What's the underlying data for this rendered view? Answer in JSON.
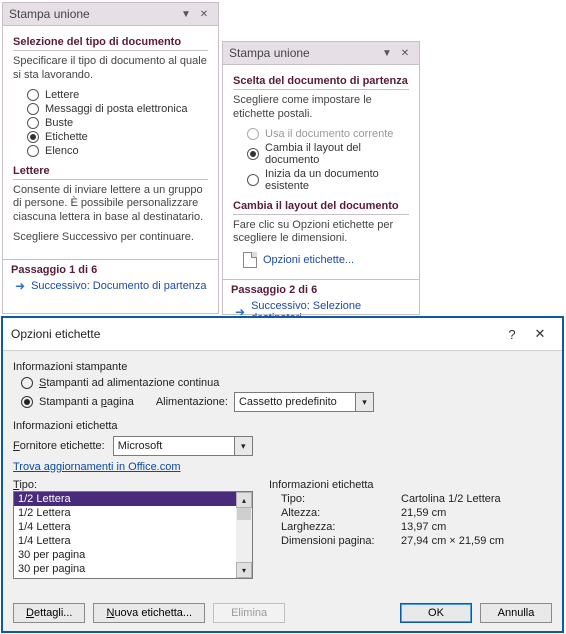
{
  "pane1": {
    "title": "Stampa unione",
    "section": "Selezione del tipo di documento",
    "desc": "Specificare il tipo di documento al quale si sta lavorando.",
    "options": [
      "Lettere",
      "Messaggi di posta elettronica",
      "Buste",
      "Etichette",
      "Elenco"
    ],
    "selected": 3,
    "infoTitle": "Lettere",
    "infoDesc": "Consente di inviare lettere a un gruppo di persone. È possibile personalizzare ciascuna lettera in base al destinatario.",
    "infoHint": "Scegliere Successivo per continuare.",
    "step": "Passaggio 1 di 6",
    "next": "Successivo: Documento di partenza"
  },
  "pane2": {
    "title": "Stampa unione",
    "section": "Scelta del documento di partenza",
    "desc": "Scegliere come impostare le etichette postali.",
    "options": [
      {
        "label": "Usa il documento corrente",
        "disabled": true
      },
      {
        "label": "Cambia il layout del documento",
        "disabled": false
      },
      {
        "label": "Inizia da un documento esistente",
        "disabled": false
      }
    ],
    "selected": 1,
    "sub": {
      "title": "Cambia il layout del documento",
      "desc": "Fare clic su Opzioni etichette per scegliere le dimensioni.",
      "link": "Opzioni etichette..."
    },
    "step": "Passaggio 2 di 6",
    "next": "Successivo: Selezione destinatari"
  },
  "dialog": {
    "title": "Opzioni etichette",
    "printer": {
      "group": "Informazioni stampante",
      "opt1": "Stampanti ad alimentazione continua",
      "opt2": "Stampanti a pagina",
      "feedLabel": "Alimentazione:",
      "feedValue": "Cassetto predefinito"
    },
    "label": {
      "group": "Informazioni etichetta",
      "vendorLabel": "Fornitore etichette:",
      "vendorValue": "Microsoft",
      "updates": "Trova aggiornamenti in Office.com"
    },
    "type": {
      "label": "Tipo:",
      "items": [
        "1/2 Lettera",
        "1/2 Lettera",
        "1/4 Lettera",
        "1/4 Lettera",
        "30 per pagina",
        "30 per pagina"
      ],
      "selected": 0
    },
    "info": {
      "title": "Informazioni etichetta",
      "rows": [
        {
          "k": "Tipo:",
          "v": "Cartolina 1/2 Lettera"
        },
        {
          "k": "Altezza:",
          "v": "21,59 cm"
        },
        {
          "k": "Larghezza:",
          "v": "13,97 cm"
        },
        {
          "k": "Dimensioni pagina:",
          "v": "27,94 cm × 21,59 cm"
        }
      ]
    },
    "buttons": {
      "details": "Dettagli...",
      "newLabel": "Nuova etichetta...",
      "delete": "Elimina",
      "ok": "OK",
      "cancel": "Annulla"
    }
  }
}
